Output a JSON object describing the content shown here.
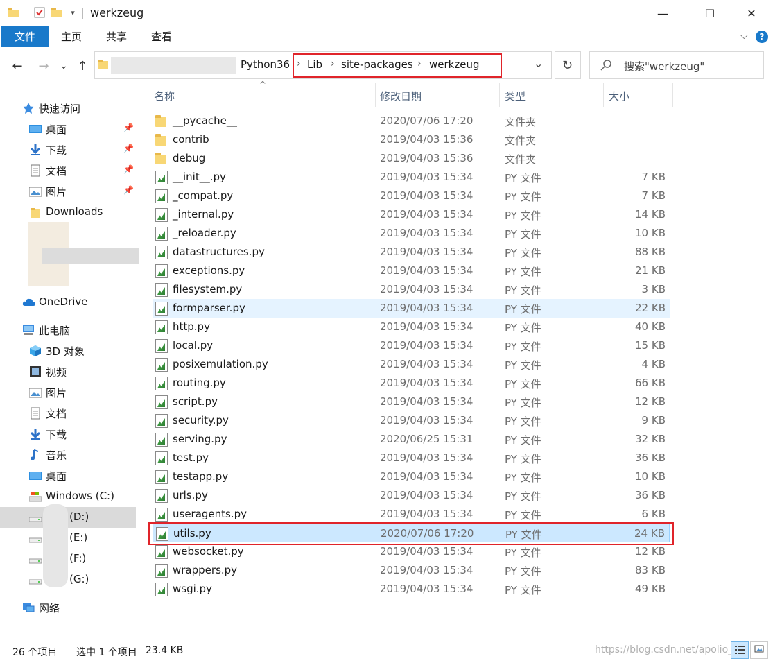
{
  "window": {
    "title": "werkzeug",
    "minimize_glyph": "—",
    "maximize_glyph": "☐",
    "close_glyph": "✕"
  },
  "ribbon": {
    "tabs": [
      "文件",
      "主页",
      "共享",
      "查看"
    ],
    "expand_glyph": "⌵",
    "help_glyph": "?"
  },
  "address": {
    "segments": [
      "Python36",
      "Lib",
      "site-packages",
      "werkzeug"
    ],
    "separator": "›",
    "dropdown_glyph": "⌄",
    "refresh_glyph": "↻"
  },
  "search": {
    "placeholder": "搜索\"werkzeug\"",
    "icon": "search-icon"
  },
  "nav": {
    "back_glyph": "←",
    "forward_glyph": "→",
    "recent_glyph": "⌄",
    "up_glyph": "↑"
  },
  "sidebar": {
    "quick_access": "快速访问",
    "quick_items": [
      {
        "label": "桌面",
        "icon": "desktop-icon",
        "pinned": true
      },
      {
        "label": "下载",
        "icon": "download-icon",
        "pinned": true
      },
      {
        "label": "文档",
        "icon": "document-icon",
        "pinned": true
      },
      {
        "label": "图片",
        "icon": "picture-icon",
        "pinned": true
      },
      {
        "label": "Downloads",
        "icon": "folder-icon",
        "pinned": false
      }
    ],
    "onedrive": "OneDrive",
    "this_pc": "此电脑",
    "pc_items": [
      {
        "label": "3D 对象",
        "icon": "cube-icon"
      },
      {
        "label": "视频",
        "icon": "video-icon"
      },
      {
        "label": "图片",
        "icon": "picture-icon"
      },
      {
        "label": "文档",
        "icon": "document-icon"
      },
      {
        "label": "下载",
        "icon": "download-icon"
      },
      {
        "label": "音乐",
        "icon": "music-icon"
      },
      {
        "label": "桌面",
        "icon": "desktop-icon"
      },
      {
        "label": "Windows (C:)",
        "icon": "drive-icon"
      },
      {
        "label": "(D:)",
        "icon": "drive-icon"
      },
      {
        "label": "(E:)",
        "icon": "drive-icon"
      },
      {
        "label": "(F:)",
        "icon": "drive-icon"
      },
      {
        "label": "(G:)",
        "icon": "drive-icon"
      }
    ],
    "network": "网络",
    "pin_glyph": "📌"
  },
  "columns": {
    "name": "名称",
    "date": "修改日期",
    "type": "类型",
    "size": "大小",
    "sort_glyph": "^"
  },
  "files": [
    {
      "name": "__pycache__",
      "date": "2020/07/06 17:20",
      "type": "文件夹",
      "size": "",
      "kind": "folder"
    },
    {
      "name": "contrib",
      "date": "2019/04/03 15:36",
      "type": "文件夹",
      "size": "",
      "kind": "folder"
    },
    {
      "name": "debug",
      "date": "2019/04/03 15:36",
      "type": "文件夹",
      "size": "",
      "kind": "folder"
    },
    {
      "name": "__init__.py",
      "date": "2019/04/03 15:34",
      "type": "PY 文件",
      "size": "7 KB",
      "kind": "py"
    },
    {
      "name": "_compat.py",
      "date": "2019/04/03 15:34",
      "type": "PY 文件",
      "size": "7 KB",
      "kind": "py"
    },
    {
      "name": "_internal.py",
      "date": "2019/04/03 15:34",
      "type": "PY 文件",
      "size": "14 KB",
      "kind": "py"
    },
    {
      "name": "_reloader.py",
      "date": "2019/04/03 15:34",
      "type": "PY 文件",
      "size": "10 KB",
      "kind": "py"
    },
    {
      "name": "datastructures.py",
      "date": "2019/04/03 15:34",
      "type": "PY 文件",
      "size": "88 KB",
      "kind": "py"
    },
    {
      "name": "exceptions.py",
      "date": "2019/04/03 15:34",
      "type": "PY 文件",
      "size": "21 KB",
      "kind": "py"
    },
    {
      "name": "filesystem.py",
      "date": "2019/04/03 15:34",
      "type": "PY 文件",
      "size": "3 KB",
      "kind": "py"
    },
    {
      "name": "formparser.py",
      "date": "2019/04/03 15:34",
      "type": "PY 文件",
      "size": "22 KB",
      "kind": "py"
    },
    {
      "name": "http.py",
      "date": "2019/04/03 15:34",
      "type": "PY 文件",
      "size": "40 KB",
      "kind": "py"
    },
    {
      "name": "local.py",
      "date": "2019/04/03 15:34",
      "type": "PY 文件",
      "size": "15 KB",
      "kind": "py"
    },
    {
      "name": "posixemulation.py",
      "date": "2019/04/03 15:34",
      "type": "PY 文件",
      "size": "4 KB",
      "kind": "py"
    },
    {
      "name": "routing.py",
      "date": "2019/04/03 15:34",
      "type": "PY 文件",
      "size": "66 KB",
      "kind": "py"
    },
    {
      "name": "script.py",
      "date": "2019/04/03 15:34",
      "type": "PY 文件",
      "size": "12 KB",
      "kind": "py"
    },
    {
      "name": "security.py",
      "date": "2019/04/03 15:34",
      "type": "PY 文件",
      "size": "9 KB",
      "kind": "py"
    },
    {
      "name": "serving.py",
      "date": "2020/06/25 15:31",
      "type": "PY 文件",
      "size": "32 KB",
      "kind": "py"
    },
    {
      "name": "test.py",
      "date": "2019/04/03 15:34",
      "type": "PY 文件",
      "size": "36 KB",
      "kind": "py"
    },
    {
      "name": "testapp.py",
      "date": "2019/04/03 15:34",
      "type": "PY 文件",
      "size": "10 KB",
      "kind": "py"
    },
    {
      "name": "urls.py",
      "date": "2019/04/03 15:34",
      "type": "PY 文件",
      "size": "36 KB",
      "kind": "py"
    },
    {
      "name": "useragents.py",
      "date": "2019/04/03 15:34",
      "type": "PY 文件",
      "size": "6 KB",
      "kind": "py"
    },
    {
      "name": "utils.py",
      "date": "2020/07/06 17:20",
      "type": "PY 文件",
      "size": "24 KB",
      "kind": "py"
    },
    {
      "name": "websocket.py",
      "date": "2019/04/03 15:34",
      "type": "PY 文件",
      "size": "12 KB",
      "kind": "py"
    },
    {
      "name": "wrappers.py",
      "date": "2019/04/03 15:34",
      "type": "PY 文件",
      "size": "83 KB",
      "kind": "py"
    },
    {
      "name": "wsgi.py",
      "date": "2019/04/03 15:34",
      "type": "PY 文件",
      "size": "49 KB",
      "kind": "py"
    }
  ],
  "status": {
    "count": "26 个项目",
    "selection": "选中 1 个项目",
    "selection_size": "23.4 KB",
    "watermark": "https://blog.csdn.net/apolio_"
  },
  "colors": {
    "accent": "#1979ca",
    "selection": "#cce8ff",
    "hover": "#e5f3ff",
    "highlight_box": "#e0242a"
  }
}
